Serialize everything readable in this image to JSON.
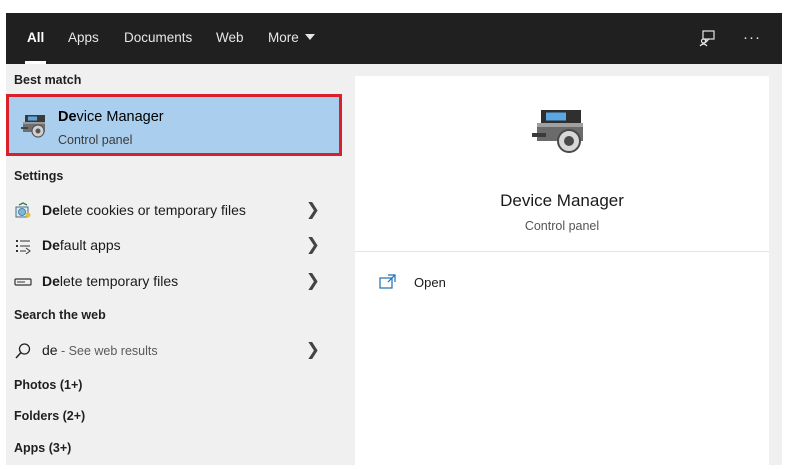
{
  "tabs": [
    {
      "label": "All",
      "active": true
    },
    {
      "label": "Apps",
      "active": false
    },
    {
      "label": "Documents",
      "active": false
    },
    {
      "label": "Web",
      "active": false
    },
    {
      "label": "More",
      "active": false
    }
  ],
  "topbar": {
    "feedback_icon": "feedback-icon",
    "options_glyph": "···"
  },
  "sections": {
    "best_match": "Best match",
    "settings": "Settings",
    "search_web": "Search the web",
    "photos": "Photos (1+)",
    "folders": "Folders (2+)",
    "apps": "Apps (3+)"
  },
  "best_match": {
    "title_bold": "De",
    "title_rest": "vice Manager",
    "subtitle": "Control panel",
    "icon": "device-manager-icon"
  },
  "settings_items": [
    {
      "bold": "De",
      "rest": "lete cookies or temporary files",
      "icon": "internet-options-icon"
    },
    {
      "bold": "De",
      "rest": "fault apps",
      "icon": "default-apps-icon"
    },
    {
      "bold": "De",
      "rest": "lete temporary files",
      "icon": "storage-icon"
    }
  ],
  "web_search": {
    "query": "de",
    "hint": " - See web results",
    "icon": "search-icon"
  },
  "preview": {
    "title": "Device Manager",
    "subtitle": "Control panel",
    "action_open": "Open"
  },
  "colors": {
    "topbar": "#202020",
    "selection": "#aacfee",
    "highlight_border": "#d9212b",
    "pane_bg": "#f0f0f0"
  }
}
